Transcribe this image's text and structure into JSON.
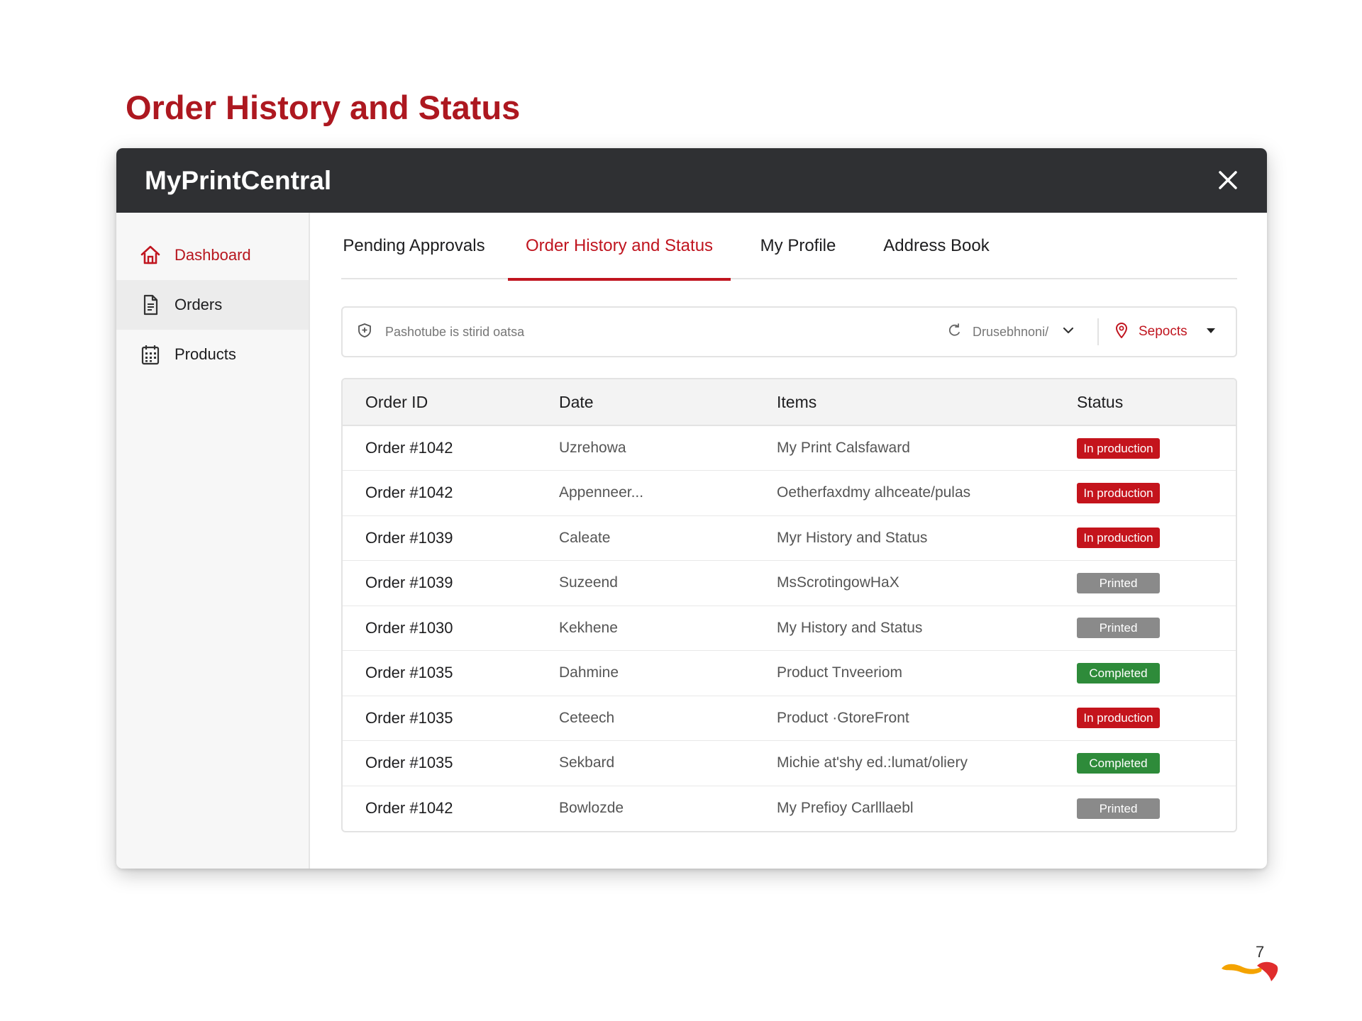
{
  "slide": {
    "title": "Order History and Status",
    "page_number": "7"
  },
  "window": {
    "app_name": "MyPrintCentral"
  },
  "sidebar": {
    "items": [
      {
        "label": "Dashboard",
        "icon": "home-icon"
      },
      {
        "label": "Orders",
        "icon": "document-icon"
      },
      {
        "label": "Products",
        "icon": "calendar-grid-icon"
      }
    ]
  },
  "tabs": [
    {
      "label": "Pending Approvals",
      "active": false
    },
    {
      "label": "Order History and Status",
      "active": true
    },
    {
      "label": "My Profile",
      "active": false
    },
    {
      "label": "Address Book",
      "active": false
    }
  ],
  "filter": {
    "search_text": "Pashotube is stirid oatsa",
    "dropdown_label": "Drusebhnoni/",
    "location_label": "Sepocts"
  },
  "table": {
    "headers": {
      "order_id": "Order ID",
      "date": "Date",
      "items": "Items",
      "status": "Status"
    },
    "rows": [
      {
        "order_id": "Order #1042",
        "date": "Uzrehowa",
        "items": "My Print Calsfaward",
        "status": "In production"
      },
      {
        "order_id": "Order #1042",
        "date": "Appenneer...",
        "items": "Oetherfaxdmy alhceate/pulas",
        "status": "In production"
      },
      {
        "order_id": "Order #1039",
        "date": "Caleate",
        "items": "Myr History and Status",
        "status": "In production"
      },
      {
        "order_id": "Order #1039",
        "date": "Suzeend",
        "items": "MsScrotingowHaX",
        "status": "Printed"
      },
      {
        "order_id": "Order #1030",
        "date": "Kekhene",
        "items": "My History and Status",
        "status": "Printed"
      },
      {
        "order_id": "Order #1035",
        "date": "Dahmine",
        "items": "Product Tnveeriom",
        "status": "Completed"
      },
      {
        "order_id": "Order #1035",
        "date": "Ceteech",
        "items": "Product ·GtoreFront",
        "status": "In production"
      },
      {
        "order_id": "Order #1035",
        "date": "Sekbard",
        "items": "Michie at'shy ed.:lumat/oliery",
        "status": "Completed"
      },
      {
        "order_id": "Order #1042",
        "date": "Bowlozde",
        "items": "My Prefioy Carlllaebl",
        "status": "Printed"
      }
    ]
  },
  "status_colors": {
    "In production": "#c4141c",
    "Printed": "#8a8a8a",
    "Completed": "#2e8b3a"
  },
  "colors": {
    "accent": "#c0151f",
    "titlebar": "#2f3033"
  }
}
